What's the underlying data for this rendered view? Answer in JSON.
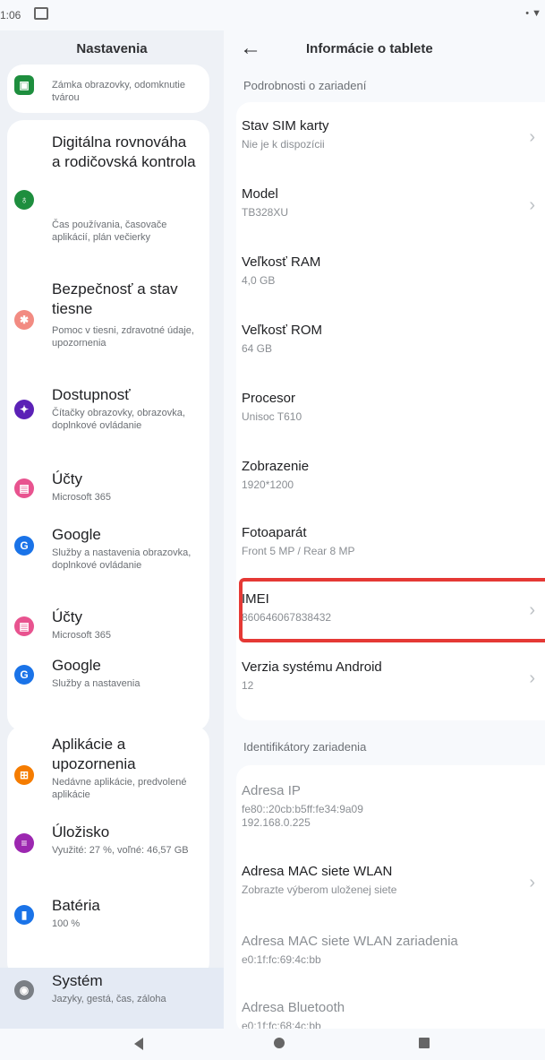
{
  "status_bar": {
    "time": "1:06",
    "right": "• ▼"
  },
  "left": {
    "title": "Nastavenia",
    "items": [
      {
        "title": "",
        "subtitle": "Zámka obrazovky, odomknutie tvárou",
        "icon": "lock-screen-icon",
        "color": "#1e8e3e"
      },
      {
        "title": "Digitálna rovnováha a rodičovská kontrola",
        "subtitle": "Čas používania, časovače aplikácií, plán večierky",
        "icon": "digital-wellbeing-icon",
        "color": "#1e8e3e"
      },
      {
        "title": "Bezpečnosť a stav tiesne",
        "subtitle": "Pomoc v tiesni, zdravotné údaje, upozornenia",
        "icon": "emergency-icon",
        "color": "#f28b82"
      },
      {
        "title": "Dostupnosť",
        "subtitle": "Čítačky obrazovky, obrazovka, doplnkové ovládanie",
        "icon": "accessibility-icon",
        "color": "#5b21b6"
      },
      {
        "title": "Účty",
        "subtitle": "Microsoft 365",
        "icon": "accounts-icon",
        "color": "#e8538f"
      },
      {
        "title": "Google",
        "subtitle": "Služby a nastavenia obrazovka, doplnkové ovládanie",
        "icon": "google-icon",
        "color": "#1a73e8"
      },
      {
        "title": "Účty",
        "subtitle": "Microsoft 365",
        "icon": "accounts-icon",
        "color": "#e8538f"
      },
      {
        "title": "Google",
        "subtitle": "Služby a nastavenia",
        "icon": "google-icon",
        "color": "#1a73e8"
      },
      {
        "title": "Aplikácie a upozornenia",
        "subtitle": "Nedávne aplikácie, predvolené aplikácie",
        "icon": "apps-icon",
        "color": "#f57c00"
      },
      {
        "title": "Úložisko",
        "subtitle": "Využité: 27 %, voľné: 46,57 GB",
        "icon": "storage-icon",
        "color": "#9c27b0"
      },
      {
        "title": "Batéria",
        "subtitle": "100 %",
        "icon": "battery-icon",
        "color": "#1a73e8"
      },
      {
        "title": "Systém",
        "subtitle": "Jazyky, gestá, čas, záloha",
        "icon": "system-icon",
        "color": "#7a7f85"
      }
    ]
  },
  "right": {
    "title": "Informácie o tablete",
    "section1": "Podrobnosti o zariadení",
    "rows": [
      {
        "title": "Stav SIM karty",
        "subtitle": "Nie je k dispozícii",
        "chevron": true
      },
      {
        "title": "Model",
        "subtitle": "TB328XU",
        "chevron": true
      },
      {
        "title": "Veľkosť RAM",
        "subtitle": "4,0 GB",
        "chevron": false
      },
      {
        "title": "Veľkosť ROM",
        "subtitle": "64 GB",
        "chevron": false
      },
      {
        "title": "Procesor",
        "subtitle": "Unisoc T610",
        "chevron": false
      },
      {
        "title": "Zobrazenie",
        "subtitle": "1920*1200",
        "chevron": false
      },
      {
        "title": "Fotoaparát",
        "subtitle": "Front 5 MP / Rear 8 MP",
        "chevron": false
      },
      {
        "title": "IMEI",
        "subtitle": "860646067838432",
        "chevron": true
      },
      {
        "title": "Verzia systému Android",
        "subtitle": "12",
        "chevron": true
      }
    ],
    "section2": "Identifikátory zariadenia",
    "id_rows": [
      {
        "title": "Adresa IP",
        "subtitle": "fe80::20cb:b5ff:fe34:9a09\n192.168.0.225",
        "muted": true
      },
      {
        "title": "Adresa MAC siete WLAN",
        "subtitle": "Zobrazte výberom uloženej siete",
        "muted": false
      },
      {
        "title": "Adresa MAC siete WLAN zariadenia",
        "subtitle": "e0:1f:fc:69:4c:bb",
        "muted": true
      },
      {
        "title": "Adresa Bluetooth",
        "subtitle": "e0:1f:fc:68:4c:bb",
        "muted": true
      }
    ]
  }
}
